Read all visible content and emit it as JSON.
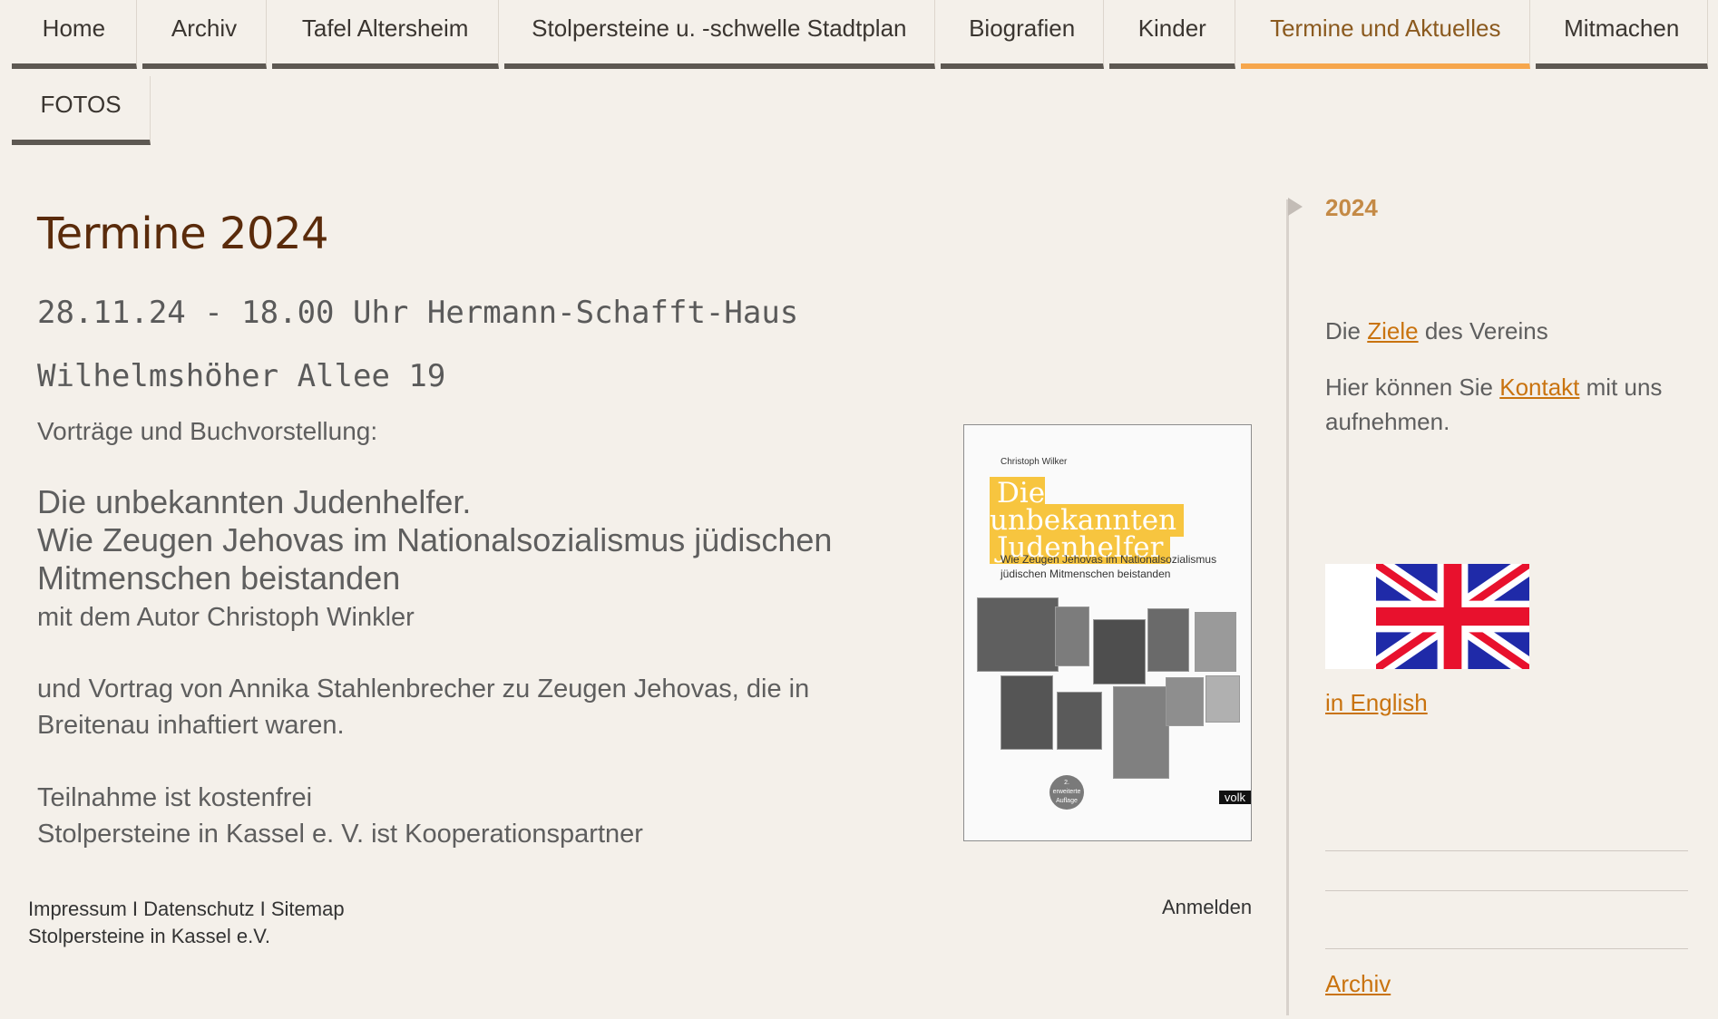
{
  "nav": {
    "row1": [
      "Home",
      "Archiv",
      "Tafel Altersheim",
      "Stolpersteine u. -schwelle Stadtplan",
      "Biografien",
      "Kinder",
      "Termine und Aktuelles",
      "Mitmachen"
    ],
    "row2": [
      "FOTOS"
    ],
    "active": "Termine und Aktuelles"
  },
  "main": {
    "title": "Termine 2024",
    "date_line": "28.11.24 - 18.00 Uhr Hermann-Schafft-Haus",
    "address": "Wilhelmshöher Allee 19",
    "intro": "Vorträge und Buchvorstellung:",
    "book_title_1": "Die unbekannten Judenhelfer.",
    "book_title_2": "Wie Zeugen Jehovas im Nationalsozialismus jüdischen Mitmenschen beistanden",
    "author_line": "mit dem Autor Christoph Winkler",
    "lecture": "und Vortrag von Annika Stahlenbrecher zu Zeugen Jehovas, die in Breitenau inhaftiert waren.",
    "free": "Teilnahme ist kostenfrei",
    "partner": "Stolpersteine in Kassel e. V. ist Kooperationspartner"
  },
  "cover": {
    "author": "Christoph Wilker",
    "title_1": "Die unbekannten",
    "title_2": "Judenhelfer",
    "subtitle": "Wie Zeugen Jehovas im Nationalsozialismus jüdischen Mitmenschen beistanden",
    "badge": "2. erweiterte Auflage",
    "publisher": "volk",
    "accent": "#f7c53f"
  },
  "footer": {
    "impressum": "Impressum",
    "datenschutz": "Datenschutz",
    "sitemap": "Sitemap",
    "sep": "I",
    "org": "Stolpersteine in Kassel e.V.",
    "login": "Anmelden"
  },
  "sidebar": {
    "year": "2024",
    "goals_pre": "Die ",
    "goals_link": "Ziele",
    "goals_post": " des Vereins",
    "contact_pre": "Hier können Sie ",
    "contact_link": "Kontakt",
    "contact_post": " mit uns aufnehmen.",
    "english": "in English",
    "archive": "Archiv"
  },
  "colors": {
    "background": "#f4f0ea",
    "title": "#5a2b0b",
    "link": "#c9730f",
    "active_tab": "#f6a64c",
    "tab_border": "#5d5852"
  }
}
